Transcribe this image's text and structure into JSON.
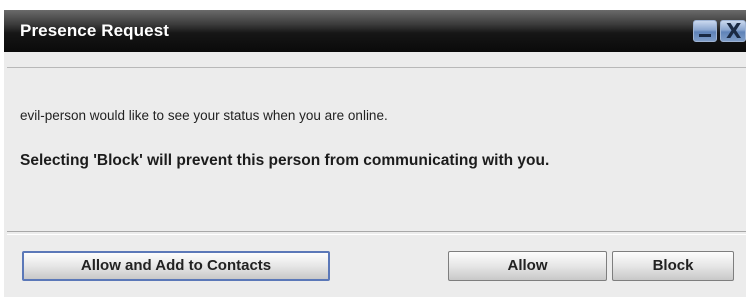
{
  "window": {
    "title": "Presence Request",
    "minimize_icon": "minimize-icon",
    "close_icon": "close-icon",
    "close_glyph": "X"
  },
  "message": {
    "line1": "evil-person would like to see your status when you are online.",
    "line2": "Selecting 'Block' will prevent this person from communicating with you."
  },
  "buttons": {
    "allow_add": "Allow and Add to Contacts",
    "allow": "Allow",
    "block": "Block"
  },
  "colors": {
    "titlebar": "#161616",
    "title_text": "#ffffff",
    "focused_button_border": "#5b78b8",
    "body": "#ececec"
  }
}
